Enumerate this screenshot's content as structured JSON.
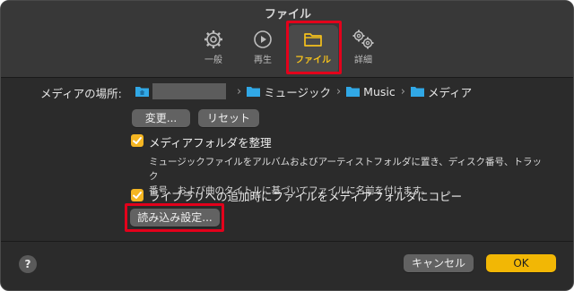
{
  "window": {
    "title": "ファイル"
  },
  "tabs": [
    {
      "label": "一般",
      "icon": "gear-icon"
    },
    {
      "label": "再生",
      "icon": "play-circle-icon"
    },
    {
      "label": "ファイル",
      "icon": "folder-icon",
      "active": true
    },
    {
      "label": "詳細",
      "icon": "gears-icon"
    }
  ],
  "media_location": {
    "label": "メディアの場所:",
    "path": [
      "ミュージック",
      "Music",
      "メディア"
    ],
    "change_button": "変更...",
    "reset_button": "リセット"
  },
  "organize": {
    "checked": true,
    "label": "メディアフォルダを整理",
    "description_line1": "ミュージックファイルをアルバムおよびアーティストフォルダに置き、ディスク番号、トラック",
    "description_line2": "番号、および曲のタイトルに基づいてファイルに名前を付けます。"
  },
  "copy_on_add": {
    "checked": true,
    "label": "ライブラリへの追加時にファイルをメディアフォルダにコピー"
  },
  "import_settings_button": "読み込み設定...",
  "footer": {
    "help": "?",
    "cancel": "キャンセル",
    "ok": "OK"
  },
  "colors": {
    "accent": "#f5b623",
    "highlight": "#e3001b",
    "folder": "#31a8e6"
  }
}
